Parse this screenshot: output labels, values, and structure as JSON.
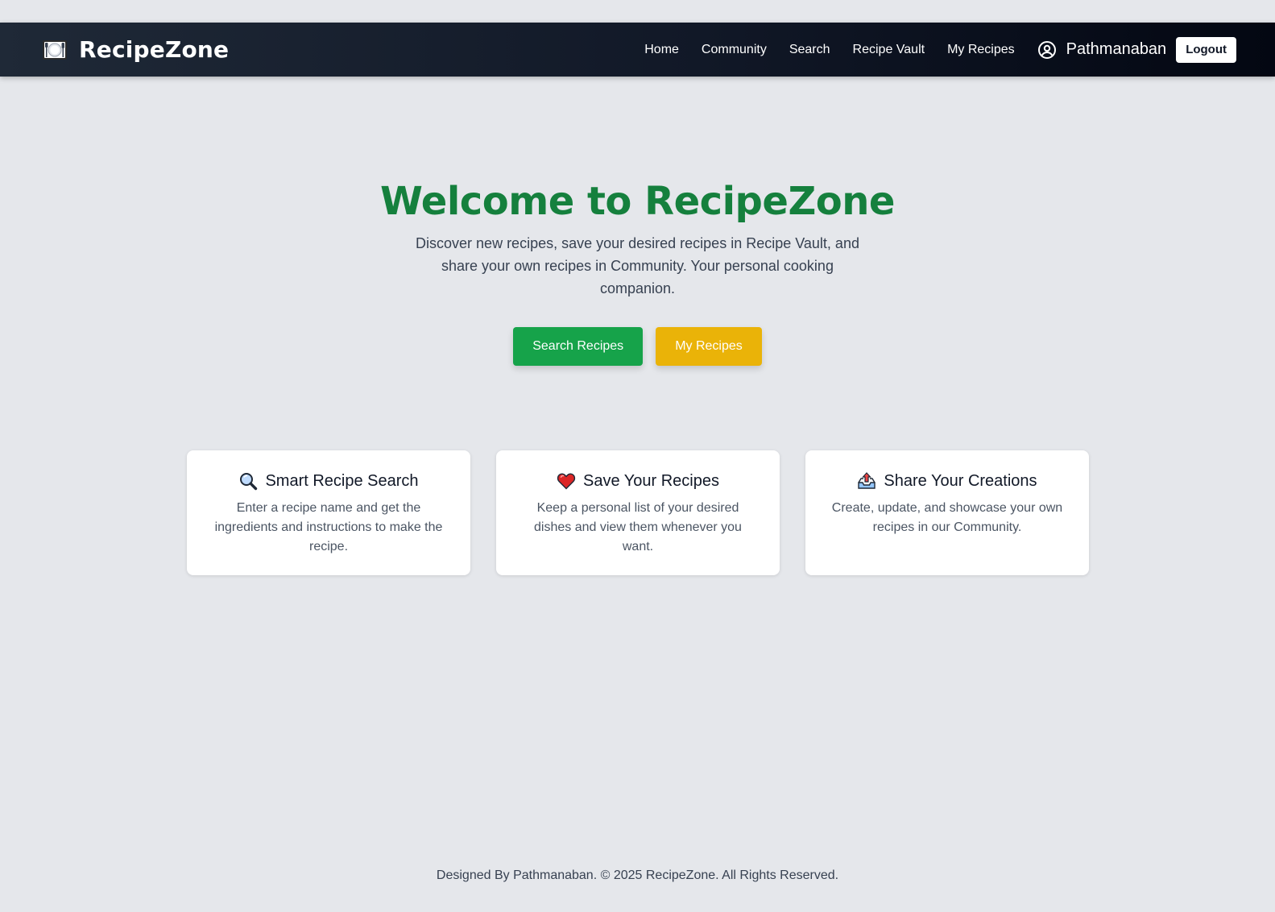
{
  "navbar": {
    "brand": "RecipeZone",
    "brand_icon": "plate-cutlery-icon",
    "links": [
      "Home",
      "Community",
      "Search",
      "Recipe Vault",
      "My Recipes"
    ],
    "user_icon": "user-circle-icon",
    "user_name": "Pathmanaban",
    "logout_label": "Logout"
  },
  "hero": {
    "title": "Welcome to RecipeZone",
    "subtitle": "Discover new recipes, save your desired recipes in Recipe Vault, and share your own recipes in Community. Your personal cooking companion.",
    "primary_button": "Search Recipes",
    "secondary_button": "My Recipes"
  },
  "features": [
    {
      "icon": "magnifier-icon",
      "title": "Smart Recipe Search",
      "description": "Enter a recipe name and get the ingredients and instructions to make the recipe."
    },
    {
      "icon": "heart-icon",
      "title": "Save Your Recipes",
      "description": "Keep a personal list of your desired dishes and view them whenever you want."
    },
    {
      "icon": "outbox-tray-icon",
      "title": "Share Your Creations",
      "description": "Create, update, and showcase your own recipes in our Community."
    }
  ],
  "footer": {
    "text": "Designed By Pathmanaban. © 2025 RecipeZone. All Rights Reserved."
  },
  "colors": {
    "page_background": "#e5e7eb",
    "navbar": "#111827",
    "hero_title": "#15803d",
    "primary_button": "#16a34a",
    "secondary_button": "#eab308"
  }
}
